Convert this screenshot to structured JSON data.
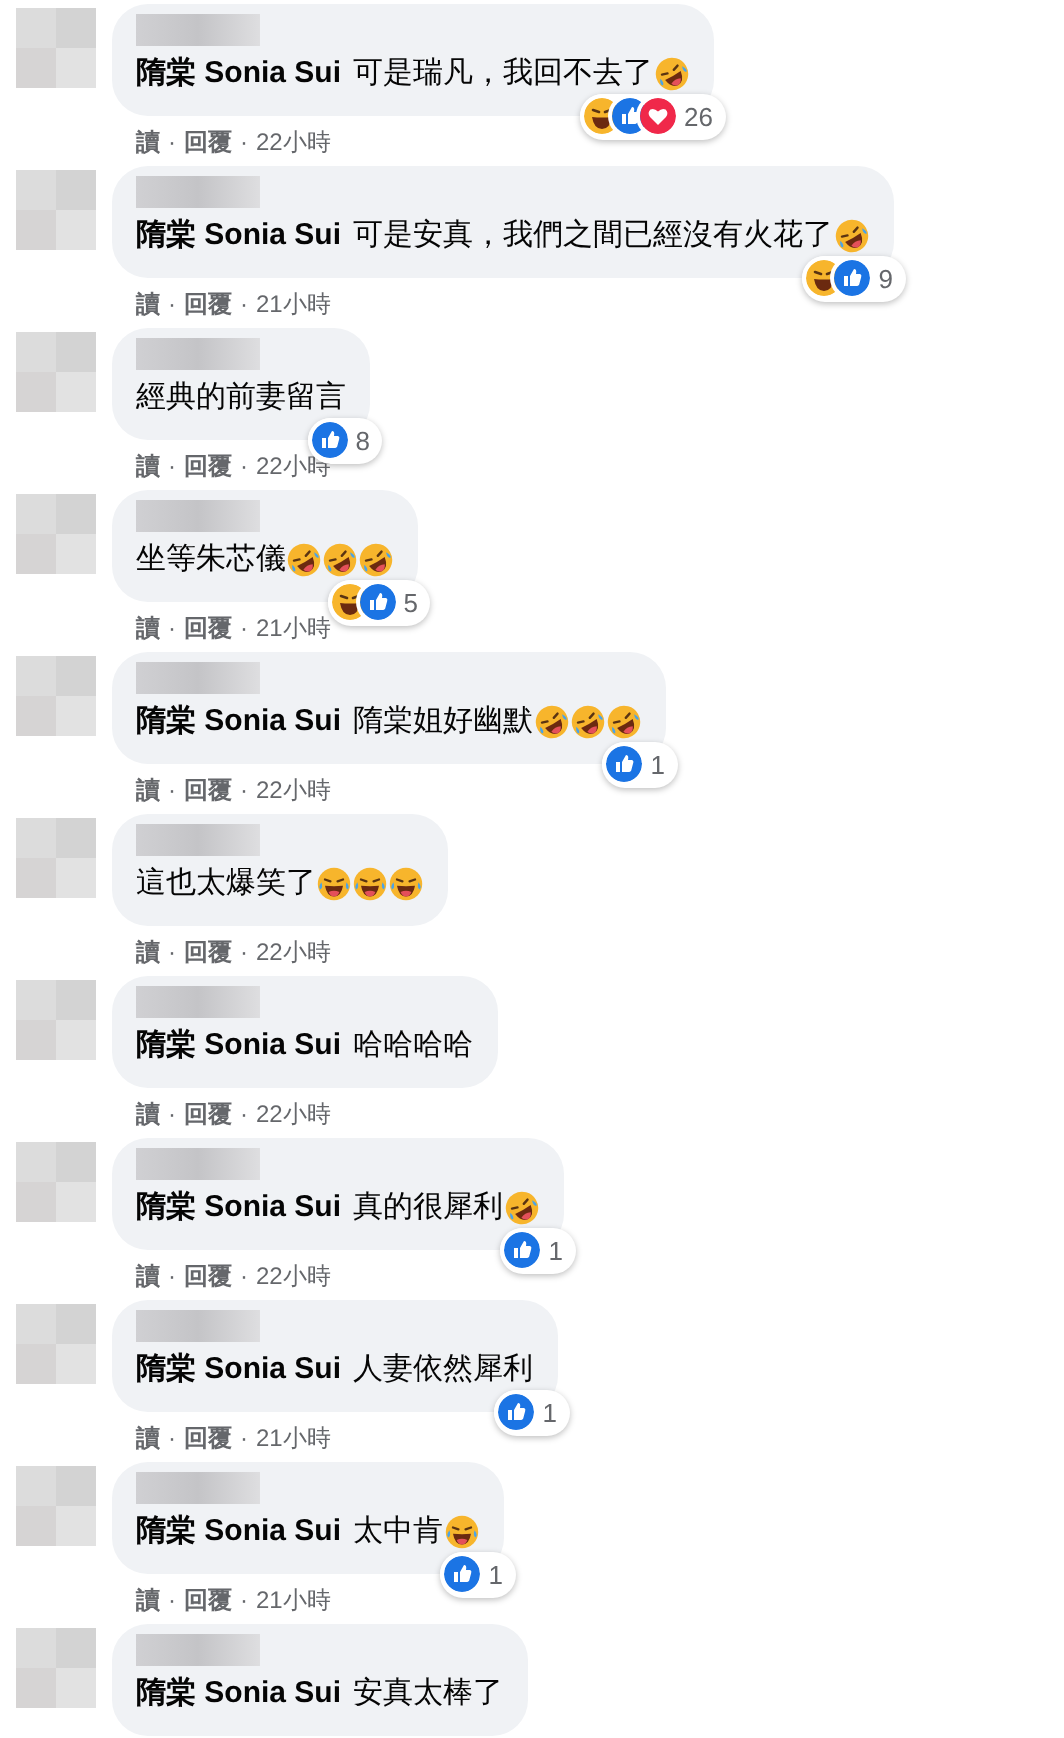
{
  "comments": [
    {
      "mention": "隋棠 Sonia Sui",
      "text": "可是瑞凡，我回不去了",
      "emojis": [
        {
          "kind": "rofl"
        }
      ],
      "reactions": {
        "icons": [
          {
            "kind": "haha"
          },
          {
            "kind": "like"
          },
          {
            "kind": "love"
          }
        ],
        "count": "26"
      },
      "meta": [
        {
          "kind": "link",
          "text": "讀"
        },
        {
          "kind": "separator",
          "text": "·"
        },
        {
          "kind": "link",
          "text": "回覆"
        },
        {
          "kind": "separator",
          "text": "·"
        },
        {
          "kind": "time",
          "text": "22小時"
        }
      ]
    },
    {
      "mention": "隋棠 Sonia Sui",
      "text": "可是安真，我們之間已經沒有火花了",
      "emojis": [
        {
          "kind": "rofl"
        }
      ],
      "reactions": {
        "icons": [
          {
            "kind": "haha"
          },
          {
            "kind": "like"
          }
        ],
        "count": "9"
      },
      "meta": [
        {
          "kind": "link",
          "text": "讀"
        },
        {
          "kind": "separator",
          "text": "·"
        },
        {
          "kind": "link",
          "text": "回覆"
        },
        {
          "kind": "separator",
          "text": "·"
        },
        {
          "kind": "time",
          "text": "21小時"
        }
      ]
    },
    {
      "text": "經典的前妻留言",
      "reactions": {
        "icons": [
          {
            "kind": "like"
          }
        ],
        "count": "8"
      },
      "meta": [
        {
          "kind": "link",
          "text": "讀"
        },
        {
          "kind": "separator",
          "text": "·"
        },
        {
          "kind": "link",
          "text": "回覆"
        },
        {
          "kind": "separator",
          "text": "·"
        },
        {
          "kind": "time",
          "text": "22小時"
        }
      ]
    },
    {
      "text": "坐等朱芯儀",
      "emojis": [
        {
          "kind": "rofl"
        },
        {
          "kind": "rofl"
        },
        {
          "kind": "rofl"
        }
      ],
      "reactions": {
        "icons": [
          {
            "kind": "haha"
          },
          {
            "kind": "like"
          }
        ],
        "count": "5"
      },
      "meta": [
        {
          "kind": "link",
          "text": "讀"
        },
        {
          "kind": "separator",
          "text": "·"
        },
        {
          "kind": "link",
          "text": "回覆"
        },
        {
          "kind": "separator",
          "text": "·"
        },
        {
          "kind": "time",
          "text": "21小時"
        }
      ]
    },
    {
      "mention": "隋棠 Sonia Sui",
      "text": "隋棠姐好幽默",
      "emojis": [
        {
          "kind": "rofl"
        },
        {
          "kind": "rofl"
        },
        {
          "kind": "rofl"
        }
      ],
      "reactions": {
        "icons": [
          {
            "kind": "like"
          }
        ],
        "count": "1"
      },
      "meta": [
        {
          "kind": "link",
          "text": "讀"
        },
        {
          "kind": "separator",
          "text": "·"
        },
        {
          "kind": "link",
          "text": "回覆"
        },
        {
          "kind": "separator",
          "text": "·"
        },
        {
          "kind": "time",
          "text": "22小時"
        }
      ]
    },
    {
      "text": "這也太爆笑了 ",
      "emojis": [
        {
          "kind": "joy"
        },
        {
          "kind": "joy"
        },
        {
          "kind": "joy"
        }
      ],
      "meta": [
        {
          "kind": "link",
          "text": "讀"
        },
        {
          "kind": "separator",
          "text": "·"
        },
        {
          "kind": "link",
          "text": "回覆"
        },
        {
          "kind": "separator",
          "text": "·"
        },
        {
          "kind": "time",
          "text": "22小時"
        }
      ]
    },
    {
      "mention": "隋棠 Sonia Sui",
      "text": "哈哈哈哈",
      "meta": [
        {
          "kind": "link",
          "text": "讀"
        },
        {
          "kind": "separator",
          "text": "·"
        },
        {
          "kind": "link",
          "text": "回覆"
        },
        {
          "kind": "separator",
          "text": "·"
        },
        {
          "kind": "time",
          "text": "22小時"
        }
      ]
    },
    {
      "mention": "隋棠 Sonia Sui",
      "text": "真的很犀利",
      "emojis": [
        {
          "kind": "rofl"
        }
      ],
      "reactions": {
        "icons": [
          {
            "kind": "like"
          }
        ],
        "count": "1"
      },
      "meta": [
        {
          "kind": "link",
          "text": "讀"
        },
        {
          "kind": "separator",
          "text": "·"
        },
        {
          "kind": "link",
          "text": "回覆"
        },
        {
          "kind": "separator",
          "text": "·"
        },
        {
          "kind": "time",
          "text": "22小時"
        }
      ]
    },
    {
      "mention": "隋棠 Sonia Sui",
      "text": "人妻依然犀利",
      "reactions": {
        "icons": [
          {
            "kind": "like"
          }
        ],
        "count": "1"
      },
      "meta": [
        {
          "kind": "link",
          "text": "讀"
        },
        {
          "kind": "separator",
          "text": "·"
        },
        {
          "kind": "link",
          "text": "回覆"
        },
        {
          "kind": "separator",
          "text": "·"
        },
        {
          "kind": "time",
          "text": "21小時"
        }
      ]
    },
    {
      "mention": "隋棠 Sonia Sui",
      "text": "太中肯",
      "emojis": [
        {
          "kind": "joy"
        }
      ],
      "reactions": {
        "icons": [
          {
            "kind": "like"
          }
        ],
        "count": "1"
      },
      "meta": [
        {
          "kind": "link",
          "text": "讀"
        },
        {
          "kind": "separator",
          "text": "·"
        },
        {
          "kind": "link",
          "text": "回覆"
        },
        {
          "kind": "separator",
          "text": "·"
        },
        {
          "kind": "time",
          "text": "21小時"
        }
      ]
    },
    {
      "mention": "隋棠 Sonia Sui",
      "text": "安真太棒了"
    }
  ]
}
